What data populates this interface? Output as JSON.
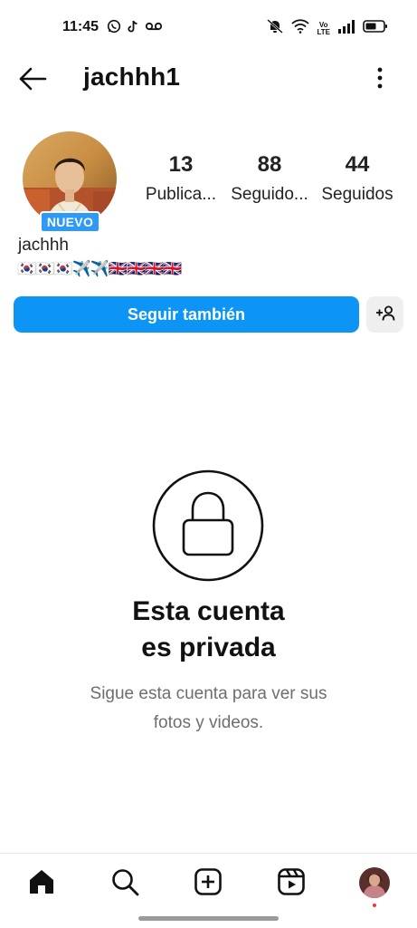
{
  "status_bar": {
    "time": "11:45",
    "left_icons": [
      "whatsapp-icon",
      "tiktok-icon",
      "voicemail-icon"
    ],
    "right_icons": [
      "mute-icon",
      "wifi-icon",
      "volte-icon",
      "signal-icon",
      "battery-icon"
    ],
    "volte_line1": "Vo",
    "volte_line2": "LTE"
  },
  "header": {
    "username": "jachhh1",
    "back_icon": "arrow-left-icon",
    "menu_icon": "more-vertical-icon"
  },
  "profile": {
    "badge": "NUEVO",
    "display_name": "jachhh",
    "bio": "🇰🇷🇰🇷🇰🇷✈️✈️🇬🇧🇬🇧🇬🇧🇬🇧",
    "stats": [
      {
        "value": "13",
        "label": "Publica..."
      },
      {
        "value": "88",
        "label": "Seguido..."
      },
      {
        "value": "44",
        "label": "Seguidos"
      }
    ]
  },
  "actions": {
    "follow_label": "Seguir también",
    "follow_color": "#0d95f6",
    "suggest_icon": "add-person-icon"
  },
  "private": {
    "title_line1": "Esta cuenta",
    "title_line2": "es privada",
    "subtitle_line1": "Sigue esta cuenta para ver sus",
    "subtitle_line2": "fotos y videos."
  },
  "bottom_nav": {
    "items": [
      "home-icon",
      "search-icon",
      "create-icon",
      "reels-icon",
      "profile-avatar"
    ],
    "notification_dot_color": "#ff3040"
  }
}
